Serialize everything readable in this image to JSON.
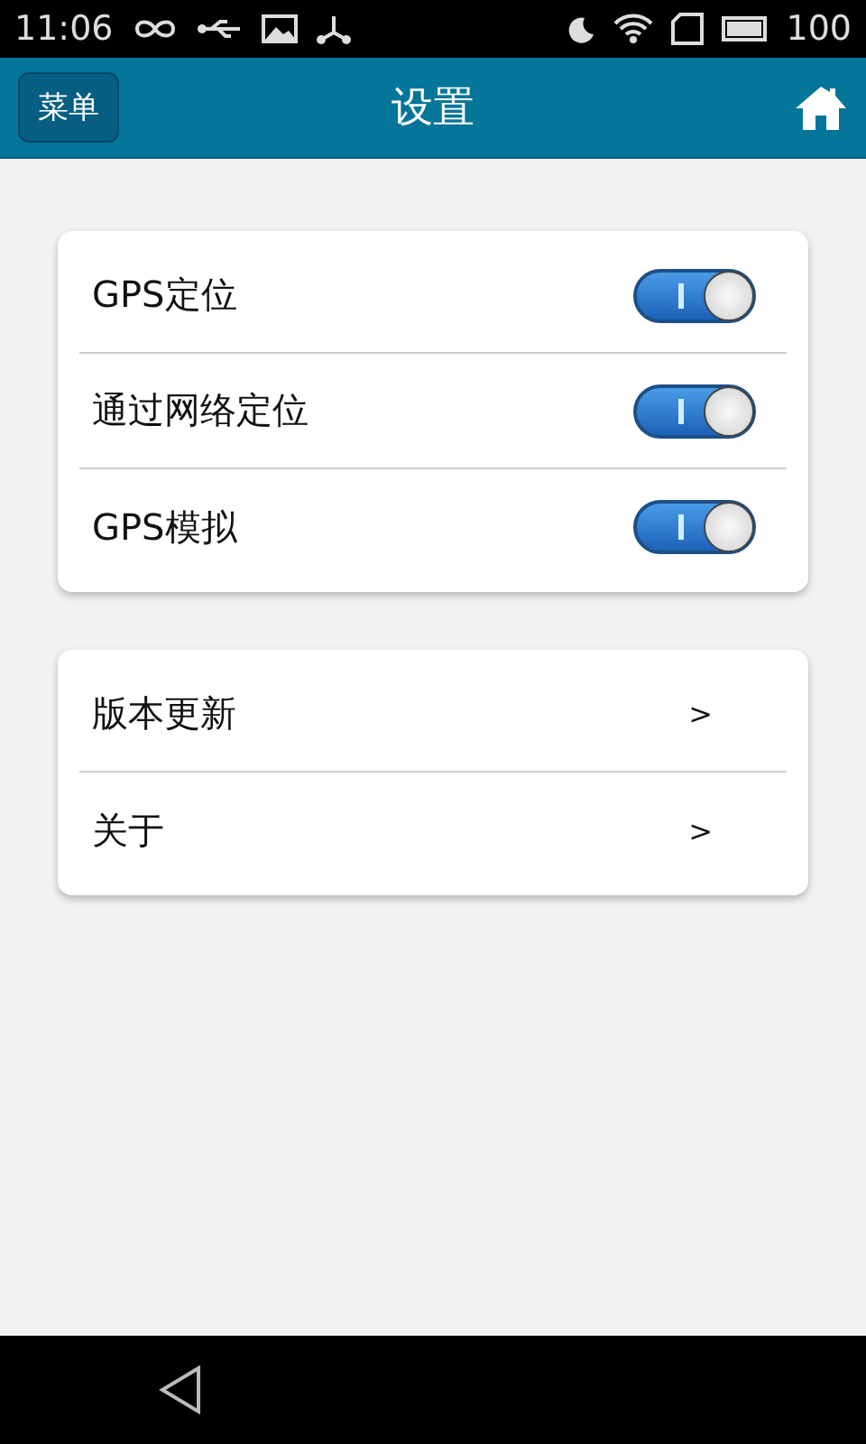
{
  "status_bar": {
    "time": "11:06",
    "battery": "100"
  },
  "header": {
    "menu_button": "菜单",
    "title": "设置"
  },
  "toggles": [
    {
      "label": "GPS定位",
      "on": true
    },
    {
      "label": "通过网络定位",
      "on": true
    },
    {
      "label": "GPS模拟",
      "on": true
    }
  ],
  "links": [
    {
      "label": "版本更新",
      "arrow": ">"
    },
    {
      "label": "关于",
      "arrow": ">"
    }
  ]
}
